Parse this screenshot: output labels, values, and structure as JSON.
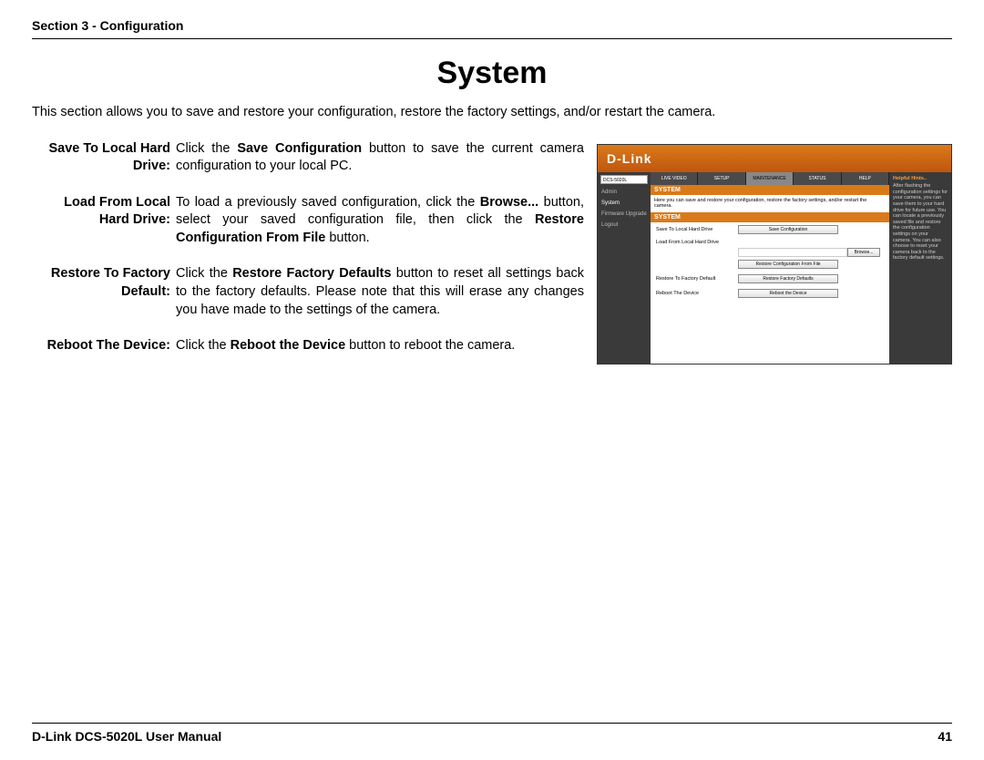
{
  "header": {
    "section": "Section 3 - Configuration"
  },
  "title": "System",
  "intro": "This section allows you to save and restore your configuration, restore the factory settings, and/or restart the camera.",
  "defs": [
    {
      "label": "Save To Local Hard Drive:",
      "body_pre": "Click the ",
      "b1": "Save Configuration",
      "body_post": " button to save the current camera configuration to your local PC."
    },
    {
      "label": "Load From Local Hard Drive:",
      "body_pre": "To load a previously saved configuration, click the ",
      "b1": "Browse...",
      "body_mid1": " button, select your saved configuration file, then click the ",
      "b2": "Restore Configuration From File",
      "body_post": " button."
    },
    {
      "label": "Restore To Factory Default:",
      "body_pre": "Click the ",
      "b1": "Restore Factory Defaults",
      "body_post": " button to reset all settings back to the factory defaults. Please note that this will erase any changes you have made to the settings of the camera."
    },
    {
      "label": "Reboot The Device:",
      "body_pre": "Click the ",
      "b1": "Reboot the Device",
      "body_post": " button to reboot the camera."
    }
  ],
  "shot": {
    "brand": "D-Link",
    "model": "DCS-5020L",
    "leftnav": [
      "Admin",
      "System",
      "Firmware Upgrade",
      "Logout"
    ],
    "tabs": [
      "LIVE VIDEO",
      "SETUP",
      "MAINTENANCE",
      "STATUS",
      "HELP"
    ],
    "systitle": "SYSTEM",
    "sysintro": "Here you can save and restore your configuration, restore the factory settings, and/or restart the camera.",
    "rows": {
      "r1": "Save To Local Hard Drive",
      "b1": "Save Configuration",
      "r2": "Load From Local Hard Drive",
      "browse": "Browse...",
      "b2": "Restore Configuration From File",
      "r3": "Restore To Factory Default",
      "b3": "Restore Factory Defaults",
      "r4": "Reboot The Device",
      "b4": "Reboot the Device"
    },
    "hint_h": "Helpful Hints..",
    "hint_t": "After flashing the configuration settings for your camera, you can save them to your hard drive for future use. You can locate a previously saved file and restore the configuration settings on your camera. You can also choose to reset your camera back to the factory default settings."
  },
  "footer": {
    "left": "D-Link DCS-5020L User Manual",
    "right": "41"
  }
}
